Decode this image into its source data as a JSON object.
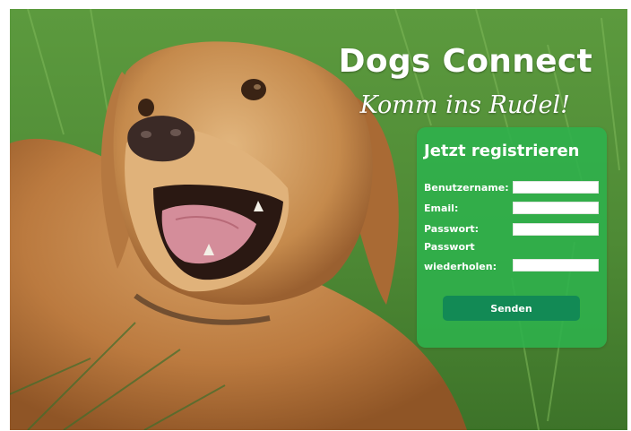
{
  "colors": {
    "grass": "#5e9b40",
    "panel": "#2eb24c",
    "button": "#128a55",
    "text": "#ffffff"
  },
  "header": {
    "title": "Dogs Connect",
    "subtitle": "Komm ins Rudel!"
  },
  "form": {
    "heading": "Jetzt registrieren",
    "fields": [
      {
        "label": "Benutzername:",
        "value": "",
        "type": "text"
      },
      {
        "label": "Email:",
        "value": "",
        "type": "email"
      },
      {
        "label": "Passwort:",
        "value": "",
        "type": "password"
      },
      {
        "label_line1": "Passwort",
        "label_line2": "wiederholen:",
        "value": "",
        "type": "password"
      }
    ],
    "submit_label": "Senden"
  }
}
